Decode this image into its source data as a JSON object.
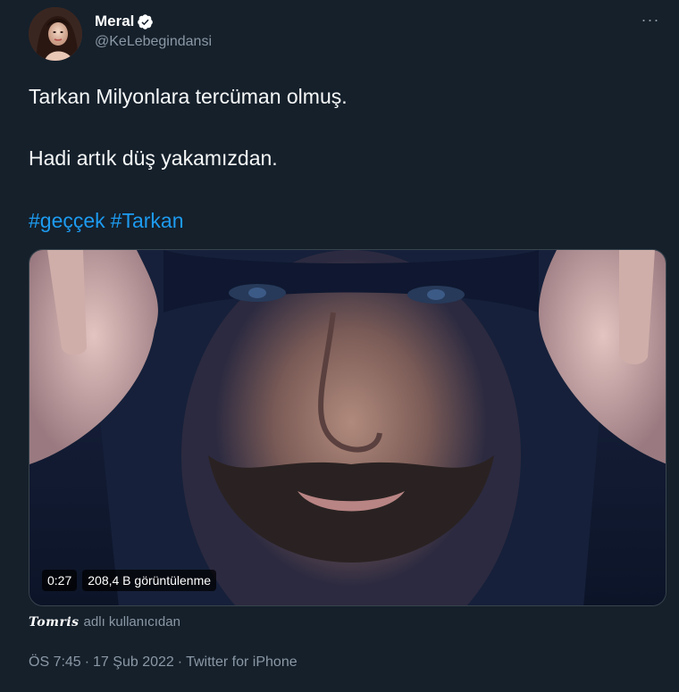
{
  "tweet": {
    "author": {
      "display_name": "Meral",
      "handle": "@KeLebegindansi",
      "verified": true,
      "avatar_icon": "profile-photo"
    },
    "more_label": "···",
    "text_lines": [
      "Tarkan Milyonlara tercüman olmuş.",
      "Hadi artık düş yakamızdan."
    ],
    "hashtags": [
      "#geççek",
      "#Tarkan"
    ],
    "media": {
      "type": "video",
      "duration": "0:27",
      "views": "208,4 B görüntülenme"
    },
    "attribution": {
      "user": "Tomris",
      "suffix": "adlı kullanıcıdan"
    },
    "meta": {
      "time": "ÖS 7:45",
      "sep1": "·",
      "date": "17 Şub 2022",
      "sep2": "·",
      "source": "Twitter for iPhone"
    }
  },
  "colors": {
    "background": "#15202b",
    "text": "#f7f9f9",
    "secondary": "#8b98a5",
    "link": "#1d9bf0",
    "verified_badge": "#ffffff"
  }
}
